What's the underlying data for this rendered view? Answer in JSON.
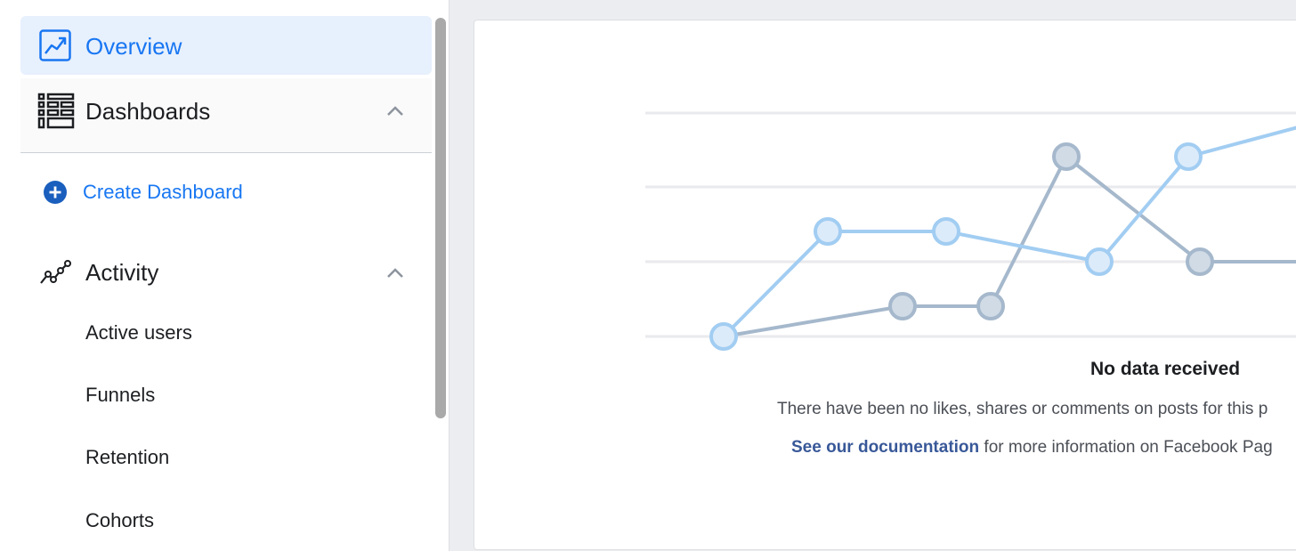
{
  "sidebar": {
    "overview_label": "Overview",
    "dashboards_label": "Dashboards",
    "create_dashboard_label": "Create Dashboard",
    "activity_label": "Activity",
    "activity_items": [
      "Active users",
      "Funnels",
      "Retention",
      "Cohorts"
    ]
  },
  "empty_state": {
    "title": "No data received",
    "description": "There have been no likes, shares or comments on posts for this p",
    "doc_link": "See our documentation",
    "doc_rest": " for more information on Facebook Pag"
  },
  "colors": {
    "accent": "#1876f2",
    "active_bg": "#e7f0fd",
    "link": "#385898",
    "series_light": "#a2cdf2",
    "series_dark": "#a5b8cc"
  },
  "icons": {
    "overview": "trend-chart-icon",
    "dashboards": "table-list-icon",
    "create": "plus-circle-icon",
    "activity": "activity-line-icon",
    "collapse": "chevron-up-icon"
  }
}
